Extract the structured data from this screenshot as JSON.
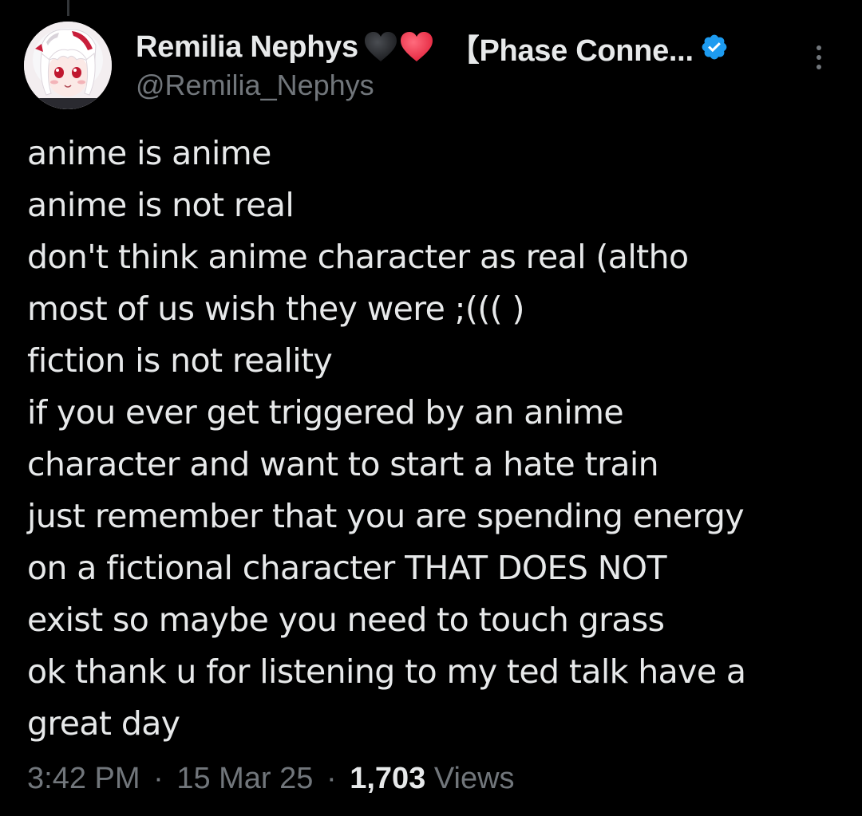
{
  "author": {
    "display_name": "Remilia Nephys",
    "affiliation": "【Phase Conne...",
    "handle": "@Remilia_Nephys",
    "verified": true,
    "avatar_icon": "anime-avatar-icon",
    "badges": [
      "black-heart-icon",
      "red-heart-icon",
      "verified-badge-icon"
    ]
  },
  "tweet": {
    "lines": [
      "anime is anime",
      "anime is not real",
      "don't think anime character as real (altho",
      "most of us wish they were ;((( )",
      "fiction is not reality",
      "if you ever get triggered by an anime",
      "character and want to start a hate train",
      "just remember that you are spending energy",
      "on a fictional character THAT DOES NOT",
      "exist so maybe you need to touch grass",
      "ok thank u for listening to my ted talk have a",
      "great day"
    ]
  },
  "meta": {
    "time": "3:42 PM",
    "separator": "·",
    "date": "15 Mar 25",
    "views_count": "1,703",
    "views_label": "Views"
  },
  "colors": {
    "background": "#000000",
    "primary_text": "#e7e9ea",
    "secondary_text": "#71767b",
    "verified_blue": "#1d9bf0",
    "red_heart": "#f4364c",
    "black_heart": "#2f3336"
  }
}
